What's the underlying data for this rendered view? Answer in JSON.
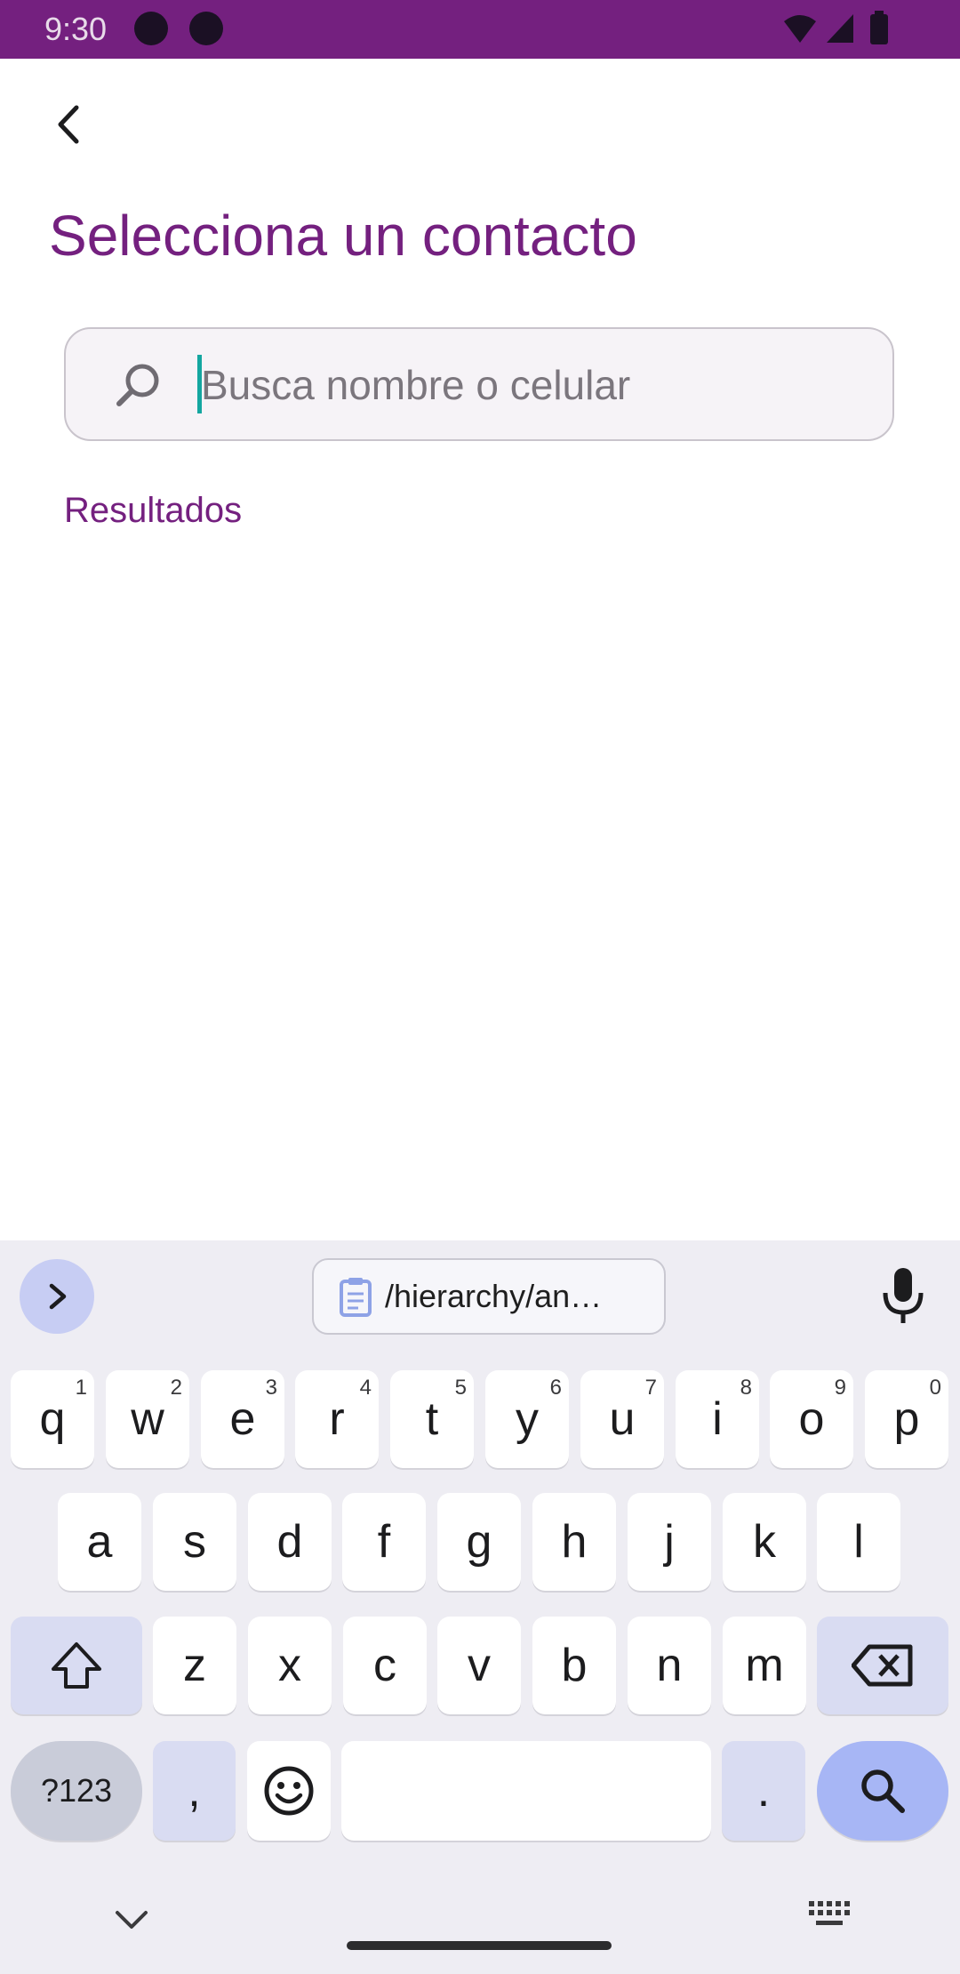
{
  "status_bar": {
    "time": "9:30"
  },
  "page": {
    "title": "Selecciona un contacto",
    "results_label": "Resultados"
  },
  "search": {
    "placeholder": "Busca nombre o celular",
    "value": ""
  },
  "keyboard": {
    "clipboard_text": "/hierarchy/an…",
    "row1": [
      {
        "k": "q",
        "h": "1"
      },
      {
        "k": "w",
        "h": "2"
      },
      {
        "k": "e",
        "h": "3"
      },
      {
        "k": "r",
        "h": "4"
      },
      {
        "k": "t",
        "h": "5"
      },
      {
        "k": "y",
        "h": "6"
      },
      {
        "k": "u",
        "h": "7"
      },
      {
        "k": "i",
        "h": "8"
      },
      {
        "k": "o",
        "h": "9"
      },
      {
        "k": "p",
        "h": "0"
      }
    ],
    "row2": [
      "a",
      "s",
      "d",
      "f",
      "g",
      "h",
      "j",
      "k",
      "l"
    ],
    "row3": [
      "z",
      "x",
      "c",
      "v",
      "b",
      "n",
      "m"
    ],
    "sym_label": "?123",
    "comma": ",",
    "period": "."
  },
  "colors": {
    "brand": "#74207f",
    "cursor": "#14a6a0",
    "search_key": "#a7b6f5"
  }
}
